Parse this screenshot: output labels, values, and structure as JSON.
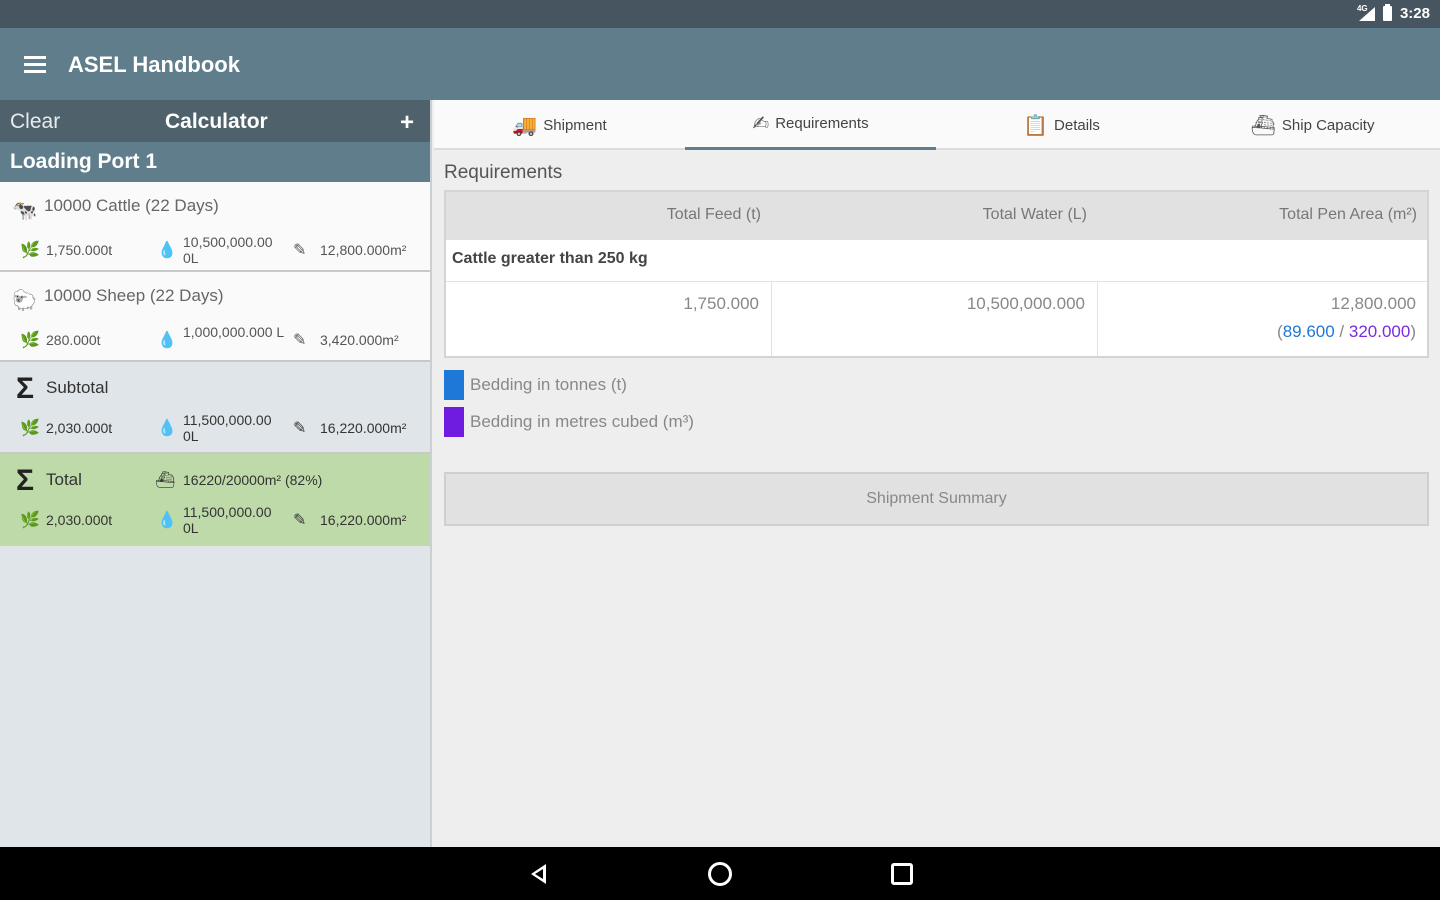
{
  "status": {
    "time": "3:28",
    "signal_label": "4G"
  },
  "appbar": {
    "title": "ASEL Handbook",
    "menu_icon": "hamburger-icon"
  },
  "calculator": {
    "clear_label": "Clear",
    "title": "Calculator",
    "add_label": "+",
    "port_title": "Loading Port 1",
    "entries": [
      {
        "name": "10000 Cattle (22 Days)",
        "icon": "cattle-icon",
        "feed": "1,750.000t",
        "water": "10,500,000.00 0L",
        "pen": "12,800.000m²"
      },
      {
        "name": "10000 Sheep (22 Days)",
        "icon": "sheep-icon",
        "feed": "280.000t",
        "water": "1,000,000.000 L",
        "pen": "3,420.000m²"
      }
    ],
    "subtotal": {
      "name": "Subtotal",
      "feed": "2,030.000t",
      "water": "11,500,000.00 0L",
      "pen": "16,220.000m²"
    },
    "total": {
      "name": "Total",
      "capacity": "16220/20000m² (82%)",
      "feed": "2,030.000t",
      "water": "11,500,000.00 0L",
      "pen": "16,220.000m²"
    }
  },
  "tabs": [
    {
      "label": "Shipment",
      "icon": "truck-icon"
    },
    {
      "label": "Requirements",
      "icon": "edit-icon"
    },
    {
      "label": "Details",
      "icon": "clipboard-icon"
    },
    {
      "label": "Ship Capacity",
      "icon": "ship-icon"
    }
  ],
  "requirements": {
    "title": "Requirements",
    "columns": [
      "Total Feed (t)",
      "Total Water (L)",
      "Total Pen Area (m²)"
    ],
    "group": "Cattle greater than 250 kg",
    "row": {
      "feed": "1,750.000",
      "water": "10,500,000.000",
      "pen": "12,800.000",
      "bedding_open": "(",
      "bedding_tonnes": "89.600",
      "bedding_sep": " / ",
      "bedding_m3": "320.000",
      "bedding_close": ")"
    },
    "legend": [
      {
        "label": "Bedding in tonnes (t)",
        "color": "#1e78d7"
      },
      {
        "label": "Bedding in metres cubed (m³)",
        "color": "#6f1ce0"
      }
    ],
    "summary_button": "Shipment Summary"
  },
  "colors": {
    "primary": "#607d8b",
    "dark": "#4f616b",
    "total_bg": "#bedaa9"
  }
}
